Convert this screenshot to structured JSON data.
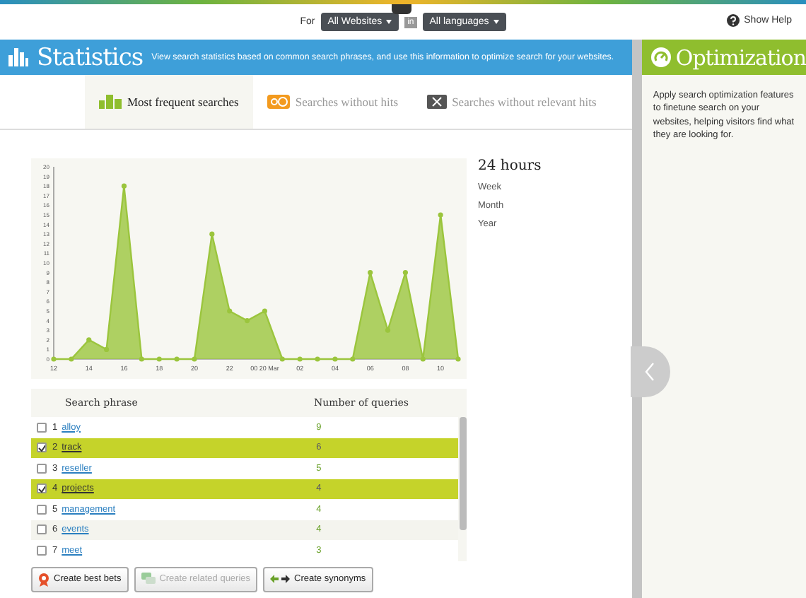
{
  "top_bar": {
    "for_label": "For",
    "website_dropdown": "All Websites",
    "in_label": "in",
    "language_dropdown": "All languages",
    "help": "Show Help"
  },
  "header": {
    "title": "Statistics",
    "description": "View search statistics based on common search phrases, and use this information to optimize search for your websites."
  },
  "side_panel": {
    "title": "Optimization",
    "text": "Apply search optimization features to finetune search on your websites, helping visitors find what they are looking for."
  },
  "tabs": [
    {
      "label": "Most frequent searches",
      "kind": "frequent",
      "selected": true
    },
    {
      "label": "Searches without hits",
      "kind": "nohits",
      "selected": false
    },
    {
      "label": "Searches without relevant hits",
      "kind": "norelevant",
      "selected": false
    }
  ],
  "periods": [
    {
      "label": "24 hours",
      "selected": true
    },
    {
      "label": "Week",
      "selected": false
    },
    {
      "label": "Month",
      "selected": false
    },
    {
      "label": "Year",
      "selected": false
    }
  ],
  "chart_data": {
    "type": "area",
    "categories": [
      "12",
      null,
      "14",
      null,
      "16",
      null,
      "18",
      null,
      "20",
      null,
      "22",
      null,
      "00 20 Mar",
      null,
      "02",
      null,
      "04",
      null,
      "06",
      null,
      "08",
      null,
      "10",
      null
    ],
    "series": [
      {
        "color": "#9bc53d",
        "values": [
          0,
          0,
          2,
          1,
          18,
          0,
          0,
          0,
          0,
          13,
          5,
          4,
          5,
          0,
          0,
          0,
          0,
          0,
          9,
          3,
          9,
          0,
          15,
          0
        ]
      }
    ],
    "ylim": [
      0,
      20
    ],
    "yticks": [
      0,
      1,
      2,
      3,
      4,
      5,
      6,
      7,
      8,
      9,
      10,
      11,
      12,
      13,
      14,
      15,
      16,
      17,
      18,
      19,
      20
    ]
  },
  "table": {
    "columns": [
      "Search phrase",
      "Number of queries"
    ],
    "rows": [
      {
        "rank": "1",
        "phrase": "alloy",
        "count": "9",
        "selected": false
      },
      {
        "rank": "2",
        "phrase": "track",
        "count": "6",
        "selected": true
      },
      {
        "rank": "3",
        "phrase": "reseller",
        "count": "5",
        "selected": false
      },
      {
        "rank": "4",
        "phrase": "projects",
        "count": "4",
        "selected": true
      },
      {
        "rank": "5",
        "phrase": "management",
        "count": "4",
        "selected": false
      },
      {
        "rank": "6",
        "phrase": "events",
        "count": "4",
        "selected": false
      },
      {
        "rank": "7",
        "phrase": "meet",
        "count": "3",
        "selected": false
      }
    ]
  },
  "actions": [
    {
      "label": "Create best bets",
      "kind": "bestbets",
      "disabled": false
    },
    {
      "label": "Create related queries",
      "kind": "related",
      "disabled": true
    },
    {
      "label": "Create synonyms",
      "kind": "synonyms",
      "disabled": false
    }
  ]
}
